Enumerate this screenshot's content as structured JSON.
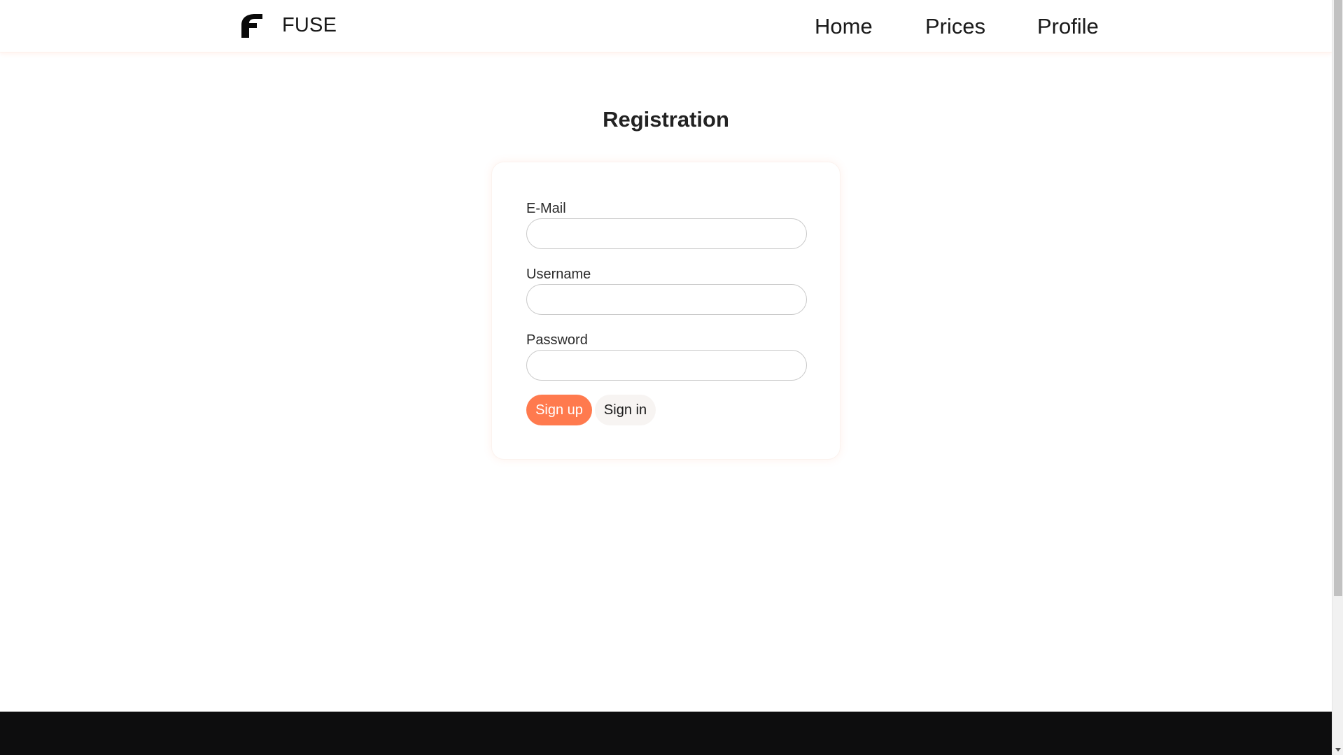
{
  "header": {
    "brand_name": "FUSE",
    "logo_icon": "fuse-logo-icon",
    "nav": [
      {
        "label": "Home"
      },
      {
        "label": "Prices"
      },
      {
        "label": "Profile"
      }
    ]
  },
  "main": {
    "title": "Registration",
    "form": {
      "email": {
        "label": "E-Mail",
        "value": "",
        "placeholder": ""
      },
      "username": {
        "label": "Username",
        "value": "",
        "placeholder": ""
      },
      "password": {
        "label": "Password",
        "value": "",
        "placeholder": ""
      },
      "signup_label": "Sign up",
      "signin_label": "Sign in"
    }
  },
  "colors": {
    "accent": "#ff7a4e",
    "footer": "#0d0d0e",
    "secondary_button": "#f7f4f2"
  },
  "scrollbar": {
    "down_icon": "scroll-down-arrow-icon"
  }
}
